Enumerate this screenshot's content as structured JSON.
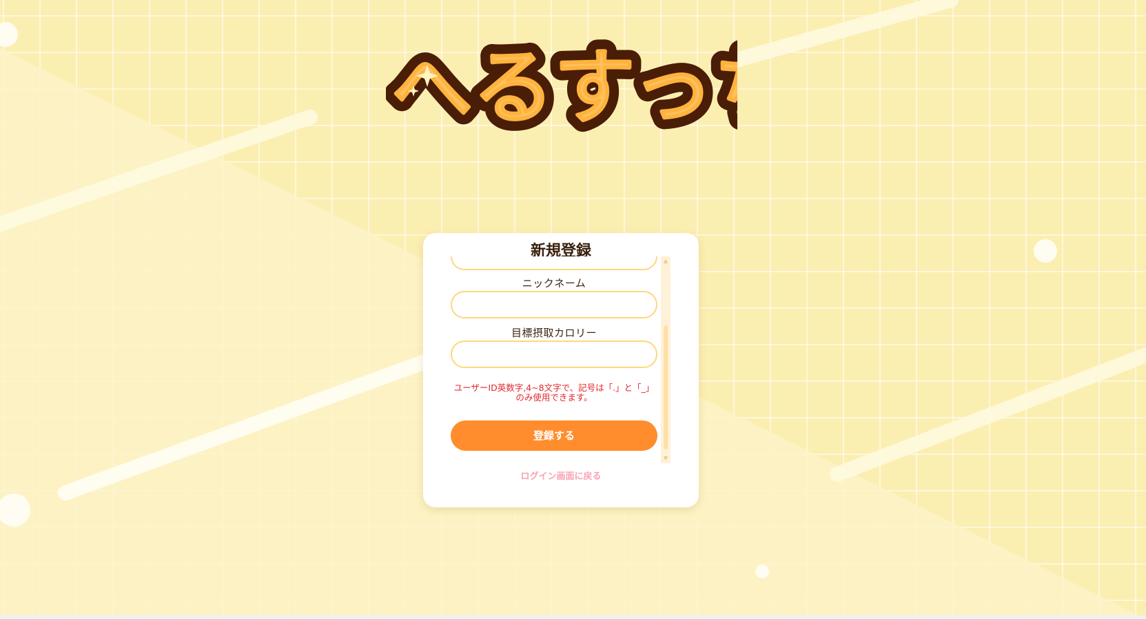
{
  "app": {
    "logo_text": "へるすっち"
  },
  "form": {
    "title": "新規登録",
    "fields": [
      {
        "label": "ニックネーム",
        "value": ""
      },
      {
        "label": "目標摂取カロリー",
        "value": ""
      }
    ],
    "error_message": "ユーザーID英数字,4~8文字で、記号は「.」と「_」のみ使用できます。",
    "submit_label": "登録する",
    "back_link_label": "ログイン画面に戻る"
  },
  "colors": {
    "background": "#fbeeb1",
    "accent": "#ff8d2d",
    "input_border": "#fdd87a",
    "error": "#e0262a",
    "link": "#f7a3b3",
    "title": "#3a200c"
  },
  "icons": [
    "sparkle-icon",
    "scroll-up-arrow-icon",
    "scroll-down-arrow-icon"
  ]
}
